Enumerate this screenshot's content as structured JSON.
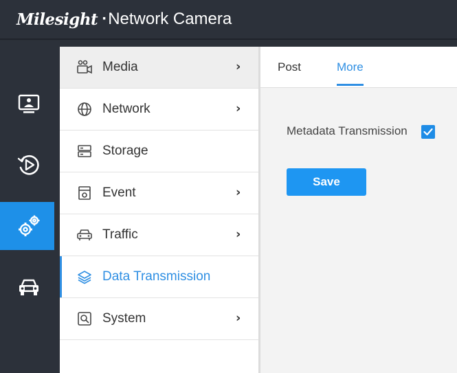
{
  "header": {
    "brand": "Milesight",
    "product": "Network Camera"
  },
  "rail": {
    "items": [
      {
        "icon": "live-view-monitor-icon",
        "active": false
      },
      {
        "icon": "playback-icon",
        "active": false
      },
      {
        "icon": "settings-gears-icon",
        "active": true
      },
      {
        "icon": "vehicle-recognition-icon",
        "active": false
      }
    ]
  },
  "menu": {
    "items": [
      {
        "label": "Media",
        "icon": "media-camera-icon",
        "has_children": true
      },
      {
        "label": "Network",
        "icon": "globe-icon",
        "has_children": true
      },
      {
        "label": "Storage",
        "icon": "storage-icon",
        "has_children": false
      },
      {
        "label": "Event",
        "icon": "event-icon",
        "has_children": true
      },
      {
        "label": "Traffic",
        "icon": "car-icon",
        "has_children": true
      },
      {
        "label": "Data Transmission",
        "icon": "layers-icon",
        "has_children": false,
        "active": true
      },
      {
        "label": "System",
        "icon": "system-icon",
        "has_children": true
      }
    ],
    "chevron": "›"
  },
  "content": {
    "tabs": [
      {
        "label": "Post",
        "active": false
      },
      {
        "label": "More",
        "active": true
      }
    ],
    "metadata_label": "Metadata Transmission",
    "metadata_checked": true,
    "save_label": "Save"
  },
  "colors": {
    "accent": "#2f8fe3",
    "header_bg": "#2c313a",
    "button": "#1e96f2"
  }
}
